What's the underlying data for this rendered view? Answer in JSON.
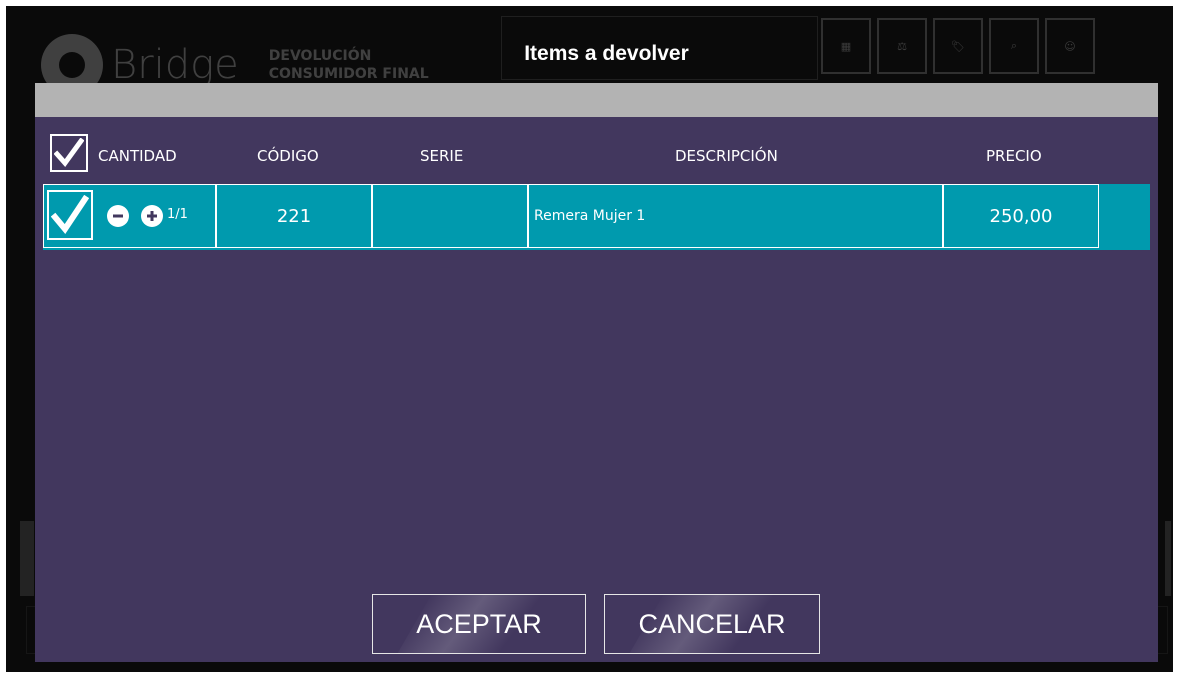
{
  "background_app": {
    "logo_text": "Bridge",
    "module_line1": "DEVOLUCIÓN",
    "module_line2": "CONSUMIDOR FINAL"
  },
  "modal": {
    "title": "Items a devolver",
    "columns": {
      "cantidad": "CANTIDAD",
      "codigo": "CÓDIGO",
      "serie": "SERIE",
      "descripcion": "DESCRIPCIÓN",
      "precio": "PRECIO"
    },
    "items": [
      {
        "checked": true,
        "quantity": "1/1",
        "codigo": "221",
        "serie": "",
        "descripcion": "Remera Mujer 1",
        "precio": "250,00"
      }
    ],
    "accept_label": "ACEPTAR",
    "cancel_label": "CANCELAR"
  },
  "colors": {
    "panel": "#42375e",
    "row": "#009aae",
    "grey_bar": "#b3b3b3",
    "frame": "#0a0a0a"
  }
}
